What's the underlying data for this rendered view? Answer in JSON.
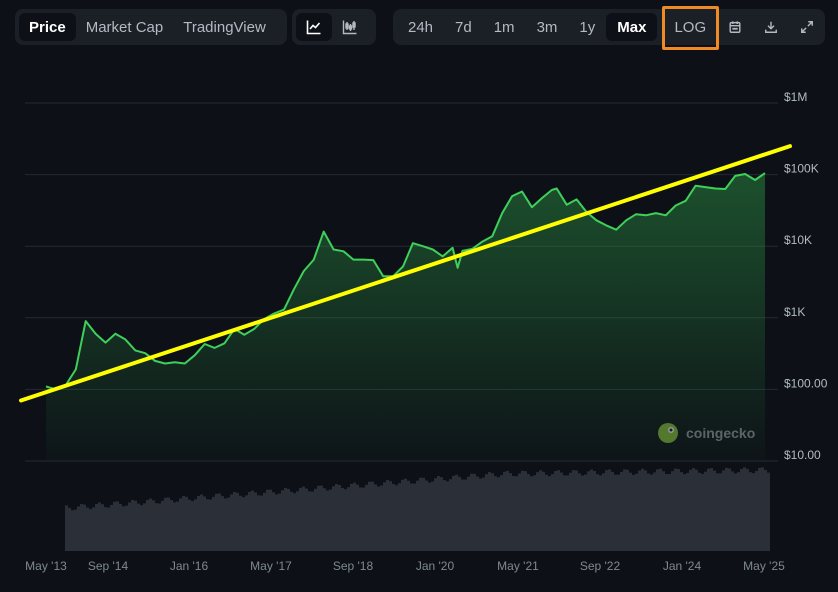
{
  "tabs": {
    "price": "Price",
    "market_cap": "Market Cap",
    "tradingview": "TradingView"
  },
  "chart_types": [
    "line-chart-icon",
    "candlestick-chart-icon"
  ],
  "ranges": [
    "24h",
    "7d",
    "1m",
    "3m",
    "1y",
    "Max"
  ],
  "active_range": "Max",
  "scale_toggle": "LOG",
  "toolbar_icons": [
    "calendar-icon",
    "download-icon",
    "fullscreen-icon"
  ],
  "watermark": "coingecko",
  "colors": {
    "price_line": "#3fcf5b",
    "trend_line": "#ffff00",
    "highlight_box": "#f08a24",
    "volume": "#2a2f38"
  },
  "chart_data": {
    "type": "line",
    "scale": "log",
    "y_ticks": [
      {
        "value": 1000000,
        "label": "$1M"
      },
      {
        "value": 100000,
        "label": "$100K"
      },
      {
        "value": 10000,
        "label": "$10K"
      },
      {
        "value": 1000,
        "label": "$1K"
      },
      {
        "value": 100,
        "label": "$100.00"
      },
      {
        "value": 10,
        "label": "$10.00"
      }
    ],
    "x_ticks": [
      "May '13",
      "Sep '14",
      "Jan '16",
      "May '17",
      "Sep '18",
      "Jan '20",
      "May '21",
      "Sep '22",
      "Jan '24",
      "May '25"
    ],
    "ylim": [
      10,
      1000000
    ],
    "grid": true,
    "price_series": [
      [
        "2013-04",
        110
      ],
      [
        "2013-06",
        100
      ],
      [
        "2013-08",
        115
      ],
      [
        "2013-10",
        190
      ],
      [
        "2013-12",
        900
      ],
      [
        "2014-02",
        600
      ],
      [
        "2014-04",
        450
      ],
      [
        "2014-06",
        600
      ],
      [
        "2014-08",
        500
      ],
      [
        "2014-10",
        350
      ],
      [
        "2014-12",
        320
      ],
      [
        "2015-02",
        250
      ],
      [
        "2015-04",
        230
      ],
      [
        "2015-06",
        240
      ],
      [
        "2015-08",
        230
      ],
      [
        "2015-10",
        300
      ],
      [
        "2015-12",
        430
      ],
      [
        "2016-02",
        380
      ],
      [
        "2016-04",
        440
      ],
      [
        "2016-06",
        700
      ],
      [
        "2016-08",
        580
      ],
      [
        "2016-10",
        700
      ],
      [
        "2016-12",
        960
      ],
      [
        "2017-02",
        1150
      ],
      [
        "2017-04",
        1300
      ],
      [
        "2017-06",
        2500
      ],
      [
        "2017-08",
        4500
      ],
      [
        "2017-10",
        6500
      ],
      [
        "2017-12",
        16000
      ],
      [
        "2018-02",
        9000
      ],
      [
        "2018-04",
        8500
      ],
      [
        "2018-06",
        6500
      ],
      [
        "2018-08",
        6500
      ],
      [
        "2018-10",
        6400
      ],
      [
        "2018-12",
        3800
      ],
      [
        "2019-02",
        3800
      ],
      [
        "2019-04",
        5200
      ],
      [
        "2019-06",
        11000
      ],
      [
        "2019-08",
        10000
      ],
      [
        "2019-10",
        9000
      ],
      [
        "2019-12",
        7200
      ],
      [
        "2020-02",
        9500
      ],
      [
        "2020-03",
        5000
      ],
      [
        "2020-04",
        8600
      ],
      [
        "2020-06",
        9200
      ],
      [
        "2020-08",
        11600
      ],
      [
        "2020-10",
        13800
      ],
      [
        "2020-12",
        29000
      ],
      [
        "2021-02",
        50000
      ],
      [
        "2021-04",
        58000
      ],
      [
        "2021-06",
        35000
      ],
      [
        "2021-08",
        47000
      ],
      [
        "2021-10",
        61000
      ],
      [
        "2021-11",
        64000
      ],
      [
        "2022-01",
        38000
      ],
      [
        "2022-03",
        45000
      ],
      [
        "2022-05",
        30000
      ],
      [
        "2022-07",
        23000
      ],
      [
        "2022-09",
        19500
      ],
      [
        "2022-11",
        17000
      ],
      [
        "2023-01",
        23000
      ],
      [
        "2023-03",
        28000
      ],
      [
        "2023-05",
        27000
      ],
      [
        "2023-07",
        29000
      ],
      [
        "2023-09",
        27000
      ],
      [
        "2023-11",
        37000
      ],
      [
        "2024-01",
        43000
      ],
      [
        "2024-03",
        70000
      ],
      [
        "2024-05",
        67000
      ],
      [
        "2024-07",
        64000
      ],
      [
        "2024-09",
        63000
      ],
      [
        "2024-11",
        96000
      ],
      [
        "2025-01",
        102000
      ],
      [
        "2025-03",
        84000
      ],
      [
        "2025-05",
        105000
      ]
    ],
    "trend_line": {
      "start": [
        "2013-03",
        70
      ],
      "end": [
        "2025-06",
        250000
      ]
    }
  }
}
